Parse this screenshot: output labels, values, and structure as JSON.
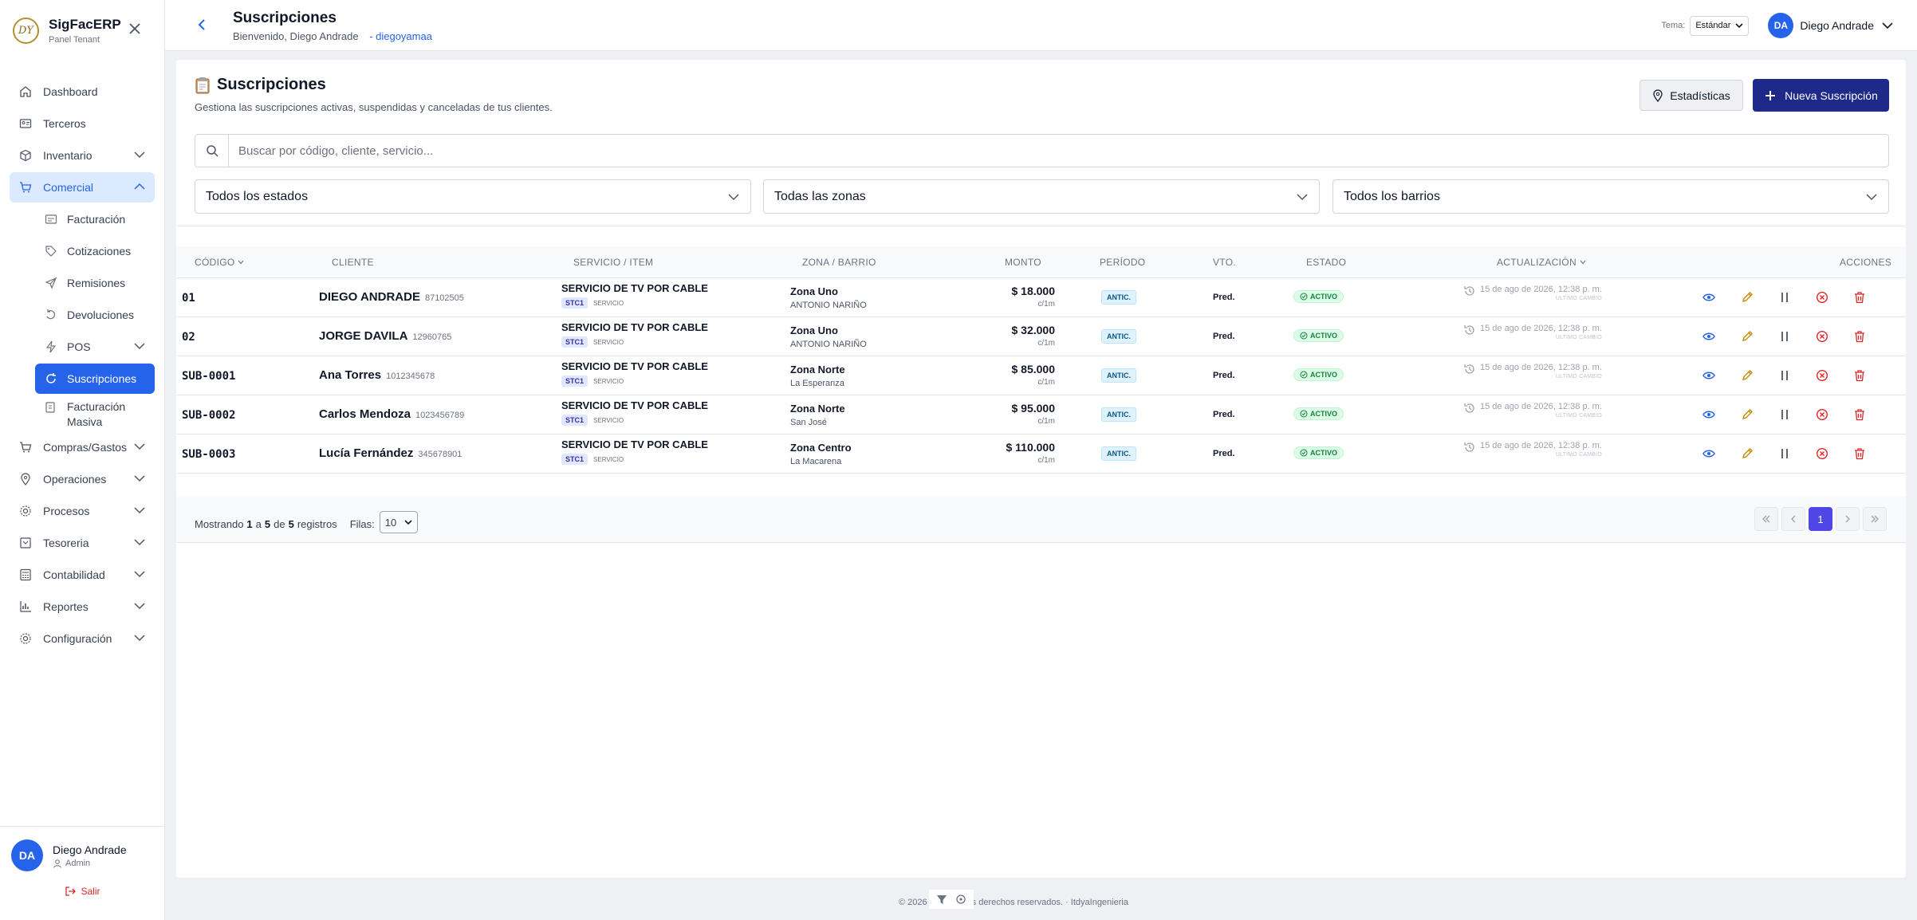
{
  "brand": {
    "logo": "DY",
    "title": "SigFacERP",
    "subtitle": "Panel Tenant"
  },
  "nav": [
    {
      "label": "Dashboard",
      "icon": "home-icon"
    },
    {
      "label": "Terceros",
      "icon": "id-card-icon"
    },
    {
      "label": "Inventario",
      "icon": "box-icon",
      "expandable": true
    },
    {
      "label": "Comercial",
      "icon": "cart-icon",
      "expandable": true,
      "open": true
    }
  ],
  "comercial_sub": [
    {
      "label": "Facturación",
      "icon": "invoice-icon"
    },
    {
      "label": "Cotizaciones",
      "icon": "tag-icon"
    },
    {
      "label": "Remisiones",
      "icon": "send-icon"
    },
    {
      "label": "Devoluciones",
      "icon": "undo-icon"
    },
    {
      "label": "POS",
      "icon": "bolt-icon",
      "expandable": true
    },
    {
      "label": "Suscripciones",
      "icon": "refresh-icon",
      "active": true
    },
    {
      "label": "Facturación Masiva",
      "icon": "stack-icon"
    }
  ],
  "nav_bottom": [
    {
      "label": "Compras/Gastos",
      "icon": "receipt-icon"
    },
    {
      "label": "Operaciones",
      "icon": "pin-icon"
    },
    {
      "label": "Procesos",
      "icon": "cog-icon"
    },
    {
      "label": "Tesoreria",
      "icon": "vault-icon"
    },
    {
      "label": "Contabilidad",
      "icon": "calc-icon"
    },
    {
      "label": "Reportes",
      "icon": "chart-icon"
    },
    {
      "label": "Configuración",
      "icon": "settings-icon"
    }
  ],
  "sidebar_user": {
    "initials": "DA",
    "name": "Diego Andrade",
    "role": "Admin",
    "logout": "Salir"
  },
  "header": {
    "title": "Suscripciones",
    "welcome": "Bienvenido, Diego Andrade",
    "tenant": "- diegoyamaa",
    "tema_label": "Tema:",
    "tema_value": "Estándar",
    "user_initials": "DA",
    "user_name": "Diego Andrade"
  },
  "page": {
    "title": "Suscripciones",
    "description": "Gestiona las suscripciones activas, suspendidas y canceladas de tus clientes.",
    "stats_button": "Estadísticas",
    "new_button": "Nueva Suscripción",
    "search_placeholder": "Buscar por código, cliente, servicio...",
    "filters": [
      "Todos los estados",
      "Todas las zonas",
      "Todos los barrios"
    ]
  },
  "table": {
    "headers": [
      "CÓDIGO",
      "CLIENTE",
      "SERVICIO / ITEM",
      "ZONA / BARRIO",
      "MONTO",
      "PERÍODO",
      "VTO.",
      "ESTADO",
      "ACTUALIZACIÓN",
      "ACCIONES"
    ],
    "rows": [
      {
        "code": "01",
        "client": "DIEGO ANDRADE",
        "nid": "87102505",
        "service": "SERVICIO DE TV POR CABLE",
        "tag": "STC1",
        "tag_sub": "SERVICIO",
        "zone": "Zona Uno",
        "barrio": "ANTONIO NARIÑO",
        "amount": "$ 18.000",
        "per": "c/1m",
        "period": "ANTIC.",
        "vto": "Pred.",
        "status": "ACTIVO",
        "updated": "15 de ago de 2026, 12:38 p. m.",
        "updated_label": "ULTIMO CAMBIO"
      },
      {
        "code": "02",
        "client": "JORGE DAVILA",
        "nid": "12960765",
        "service": "SERVICIO DE TV POR CABLE",
        "tag": "STC1",
        "tag_sub": "SERVICIO",
        "zone": "Zona Uno",
        "barrio": "ANTONIO NARIÑO",
        "amount": "$ 32.000",
        "per": "c/1m",
        "period": "ANTIC.",
        "vto": "Pred.",
        "status": "ACTIVO",
        "updated": "15 de ago de 2026, 12:38 p. m.",
        "updated_label": "ULTIMO CAMBIO"
      },
      {
        "code": "SUB-0001",
        "client": "Ana Torres",
        "nid": "1012345678",
        "service": "SERVICIO DE TV POR CABLE",
        "tag": "STC1",
        "tag_sub": "SERVICIO",
        "zone": "Zona Norte",
        "barrio": "La Esperanza",
        "amount": "$ 85.000",
        "per": "c/1m",
        "period": "ANTIC.",
        "vto": "Pred.",
        "status": "ACTIVO",
        "updated": "15 de ago de 2026, 12:38 p. m.",
        "updated_label": "ULTIMO CAMBIO"
      },
      {
        "code": "SUB-0002",
        "client": "Carlos Mendoza",
        "nid": "1023456789",
        "service": "SERVICIO DE TV POR CABLE",
        "tag": "STC1",
        "tag_sub": "SERVICIO",
        "zone": "Zona Norte",
        "barrio": "San José",
        "amount": "$ 95.000",
        "per": "c/1m",
        "period": "ANTIC.",
        "vto": "Pred.",
        "status": "ACTIVO",
        "updated": "15 de ago de 2026, 12:38 p. m.",
        "updated_label": "ULTIMO CAMBIO"
      },
      {
        "code": "SUB-0003",
        "client": "Lucía Fernández",
        "nid": "345678901",
        "service": "SERVICIO DE TV POR CABLE",
        "tag": "STC1",
        "tag_sub": "SERVICIO",
        "zone": "Zona Centro",
        "barrio": "La Macarena",
        "amount": "$ 110.000",
        "per": "c/1m",
        "period": "ANTIC.",
        "vto": "Pred.",
        "status": "ACTIVO",
        "updated": "15 de ago de 2026, 12:38 p. m.",
        "updated_label": "ULTIMO CAMBIO"
      }
    ]
  },
  "pagination": {
    "showing_prefix": "Mostrando",
    "from": "1",
    "to_word": "a",
    "to": "5",
    "of_word": "de",
    "total": "5",
    "records_word": "registros",
    "rows_label": "Filas:",
    "rows_value": "10",
    "current_page": "1"
  },
  "footer": {
    "text": "© 2026 ... Todos los derechos reservados. · ItdyaIngenieria"
  },
  "colors": {
    "primary": "#2563eb",
    "new_button": "#1e2a8a",
    "active_green": "#15803d",
    "danger": "#dc2626",
    "edit": "#ca8a04"
  }
}
